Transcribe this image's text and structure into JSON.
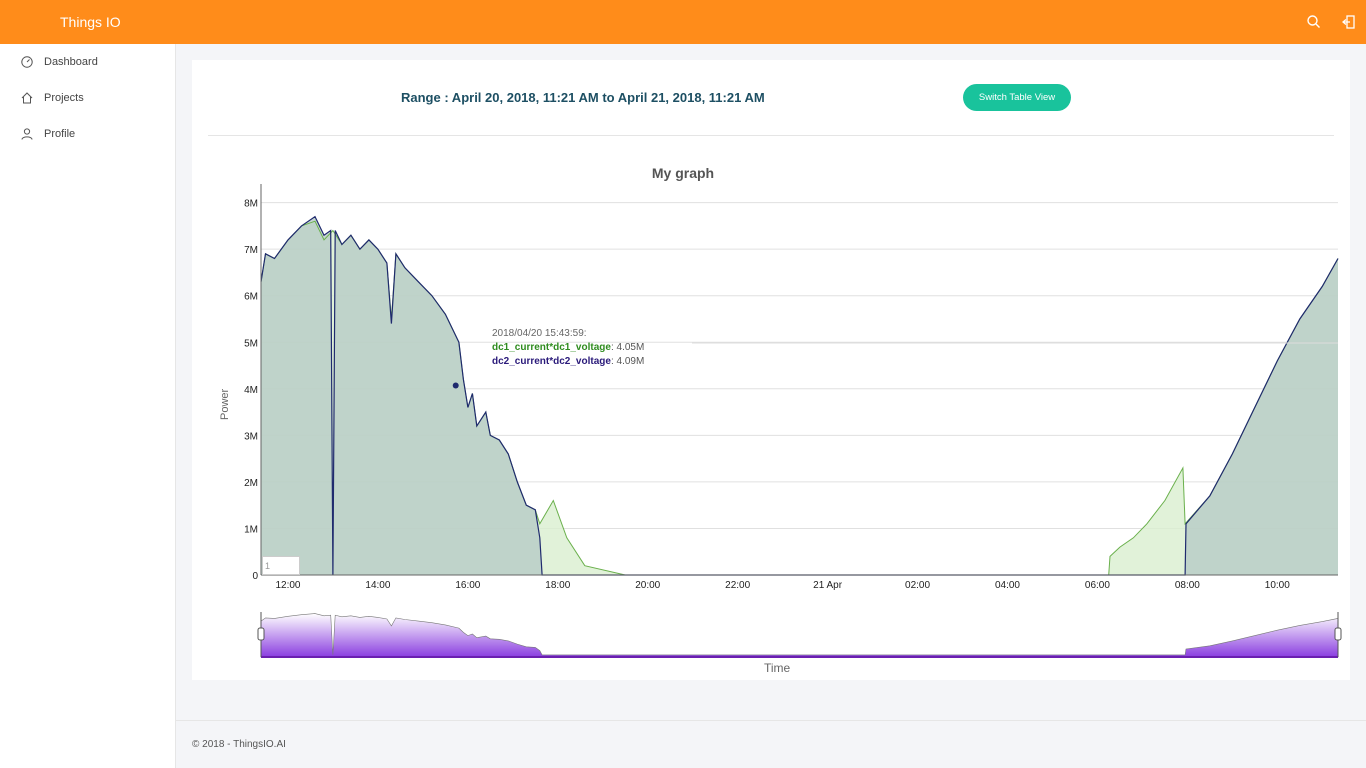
{
  "app": {
    "title": "Things IO"
  },
  "header": {
    "search_icon": "search-icon",
    "logout_icon": "logout-icon"
  },
  "sidebar": {
    "items": [
      {
        "label": "Dashboard",
        "icon": "dashboard-icon"
      },
      {
        "label": "Projects",
        "icon": "home-icon"
      },
      {
        "label": "Profile",
        "icon": "user-icon"
      }
    ]
  },
  "main": {
    "range_label": "Range : April 20, 2018, 11:21 AM to April 21, 2018, 11:21 AM",
    "switch_button": "Switch Table View",
    "roller_value": "1"
  },
  "tooltip": {
    "time": "2018/04/20 15:43:59:",
    "series1_label": "dc1_current*dc1_voltage",
    "series1_value": "4.05M",
    "series2_label": "dc2_current*dc2_voltage",
    "series2_value": "4.09M"
  },
  "footer": {
    "copyright": "© 2018 - ThingsIO.AI"
  },
  "colors": {
    "accent": "#ff8c1a",
    "button": "#19c39c",
    "series1": "#6ab04c",
    "series2": "#1f2a6e",
    "area": "#b7cbc6",
    "range_selector": "#8a3ee0"
  },
  "chart_data": {
    "type": "area",
    "title": "My graph",
    "xlabel": "Time",
    "ylabel": "Power",
    "x_ticks": [
      "12:00",
      "14:00",
      "16:00",
      "18:00",
      "20:00",
      "22:00",
      "21 Apr",
      "02:00",
      "04:00",
      "06:00",
      "08:00",
      "10:00"
    ],
    "y_ticks": [
      "0",
      "1M",
      "2M",
      "3M",
      "4M",
      "5M",
      "6M",
      "7M",
      "8M"
    ],
    "x_range_hours": [
      11.4,
      35.35
    ],
    "ylim": [
      0,
      8.4
    ],
    "y_unit": "M",
    "grid": true,
    "series": [
      {
        "name": "dc1_current*dc1_voltage",
        "points": [
          [
            11.4,
            6.3
          ],
          [
            11.5,
            6.9
          ],
          [
            11.7,
            6.8
          ],
          [
            12.0,
            7.2
          ],
          [
            12.3,
            7.5
          ],
          [
            12.6,
            7.6
          ],
          [
            12.8,
            7.2
          ],
          [
            13.0,
            7.4
          ],
          [
            13.2,
            7.1
          ],
          [
            13.4,
            7.3
          ],
          [
            13.6,
            7.0
          ],
          [
            13.8,
            7.2
          ],
          [
            14.0,
            7.0
          ],
          [
            14.2,
            6.7
          ],
          [
            14.3,
            5.5
          ],
          [
            14.4,
            6.9
          ],
          [
            14.6,
            6.6
          ],
          [
            14.9,
            6.3
          ],
          [
            15.2,
            6.0
          ],
          [
            15.5,
            5.6
          ],
          [
            15.8,
            5.0
          ],
          [
            15.9,
            4.2
          ],
          [
            16.0,
            3.6
          ],
          [
            16.1,
            3.9
          ],
          [
            16.2,
            3.2
          ],
          [
            16.4,
            3.5
          ],
          [
            16.5,
            3.0
          ],
          [
            16.7,
            2.9
          ],
          [
            16.9,
            2.6
          ],
          [
            17.1,
            2.0
          ],
          [
            17.3,
            1.5
          ],
          [
            17.5,
            1.4
          ],
          [
            17.6,
            1.1
          ],
          [
            17.9,
            1.6
          ],
          [
            18.2,
            0.8
          ],
          [
            18.6,
            0.2
          ],
          [
            19.5,
            0.0
          ],
          [
            21.0,
            0.0
          ],
          [
            24.0,
            0.0
          ],
          [
            27.0,
            0.0
          ],
          [
            30.0,
            0.0
          ],
          [
            30.25,
            0.0
          ],
          [
            30.28,
            0.4
          ],
          [
            30.5,
            0.6
          ],
          [
            30.8,
            0.8
          ],
          [
            31.1,
            1.1
          ],
          [
            31.5,
            1.6
          ],
          [
            31.9,
            2.3
          ],
          [
            31.95,
            1.1
          ],
          [
            32.5,
            1.7
          ],
          [
            33.0,
            2.6
          ],
          [
            33.5,
            3.6
          ],
          [
            34.0,
            4.6
          ],
          [
            34.5,
            5.5
          ],
          [
            35.0,
            6.2
          ],
          [
            35.35,
            6.8
          ]
        ]
      },
      {
        "name": "dc2_current*dc2_voltage",
        "points": [
          [
            11.4,
            6.3
          ],
          [
            11.5,
            6.9
          ],
          [
            11.7,
            6.8
          ],
          [
            12.0,
            7.2
          ],
          [
            12.3,
            7.5
          ],
          [
            12.6,
            7.7
          ],
          [
            12.8,
            7.3
          ],
          [
            12.95,
            7.4
          ],
          [
            13.0,
            0.0
          ],
          [
            13.05,
            7.4
          ],
          [
            13.2,
            7.1
          ],
          [
            13.4,
            7.3
          ],
          [
            13.6,
            7.0
          ],
          [
            13.8,
            7.2
          ],
          [
            14.0,
            7.0
          ],
          [
            14.2,
            6.7
          ],
          [
            14.3,
            5.4
          ],
          [
            14.4,
            6.9
          ],
          [
            14.6,
            6.6
          ],
          [
            14.9,
            6.3
          ],
          [
            15.2,
            6.0
          ],
          [
            15.5,
            5.6
          ],
          [
            15.8,
            5.0
          ],
          [
            15.9,
            4.2
          ],
          [
            16.0,
            3.6
          ],
          [
            16.1,
            3.9
          ],
          [
            16.2,
            3.2
          ],
          [
            16.4,
            3.5
          ],
          [
            16.5,
            3.0
          ],
          [
            16.7,
            2.9
          ],
          [
            16.9,
            2.6
          ],
          [
            17.1,
            2.0
          ],
          [
            17.3,
            1.5
          ],
          [
            17.5,
            1.4
          ],
          [
            17.6,
            0.8
          ],
          [
            17.65,
            0.0
          ],
          [
            20.0,
            0.0
          ],
          [
            24.0,
            0.0
          ],
          [
            28.0,
            0.0
          ],
          [
            31.95,
            0.0
          ],
          [
            31.97,
            1.1
          ],
          [
            32.5,
            1.7
          ],
          [
            33.0,
            2.6
          ],
          [
            33.5,
            3.6
          ],
          [
            34.0,
            4.6
          ],
          [
            34.5,
            5.5
          ],
          [
            35.0,
            6.2
          ],
          [
            35.35,
            6.8
          ]
        ]
      }
    ],
    "highlight": {
      "x": 15.73,
      "y": 4.07
    },
    "range_selector": true
  }
}
